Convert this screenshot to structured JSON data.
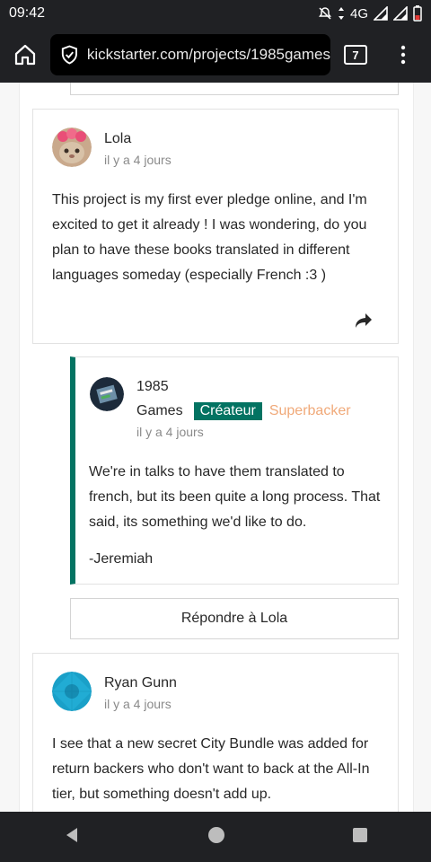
{
  "status_bar": {
    "time": "09:42",
    "network": "4G"
  },
  "browser": {
    "url": "kickstarter.com/projects/1985games",
    "tab_count": "7"
  },
  "comments": [
    {
      "author": "Lola",
      "time": "il y a 4 jours",
      "text": "This project is my first ever pledge online, and I'm excited to get it already ! I was wondering, do you plan to have these books translated in different languages someday (especially French :3 )"
    }
  ],
  "reply": {
    "author_line1": "1985",
    "author_line2": "Games",
    "badge_creator": "Créateur",
    "badge_super": "Superbacker",
    "time": "il y a 4 jours",
    "text": "We're in talks to have them translated to french, but its been quite a long process. That said, its something we'd like to do.",
    "signature": "-Jeremiah"
  },
  "reply_button": {
    "label": "Répondre à Lola"
  },
  "comment2": {
    "author": "Ryan Gunn",
    "time": "il y a 4 jours",
    "text": "I see that a new secret City Bundle was added for return backers who don't want to back at the All-In tier, but something doesn't add up."
  },
  "colors": {
    "creator_badge": "#037362",
    "superbacker": "#f0a979",
    "accent_line": "#037362"
  }
}
